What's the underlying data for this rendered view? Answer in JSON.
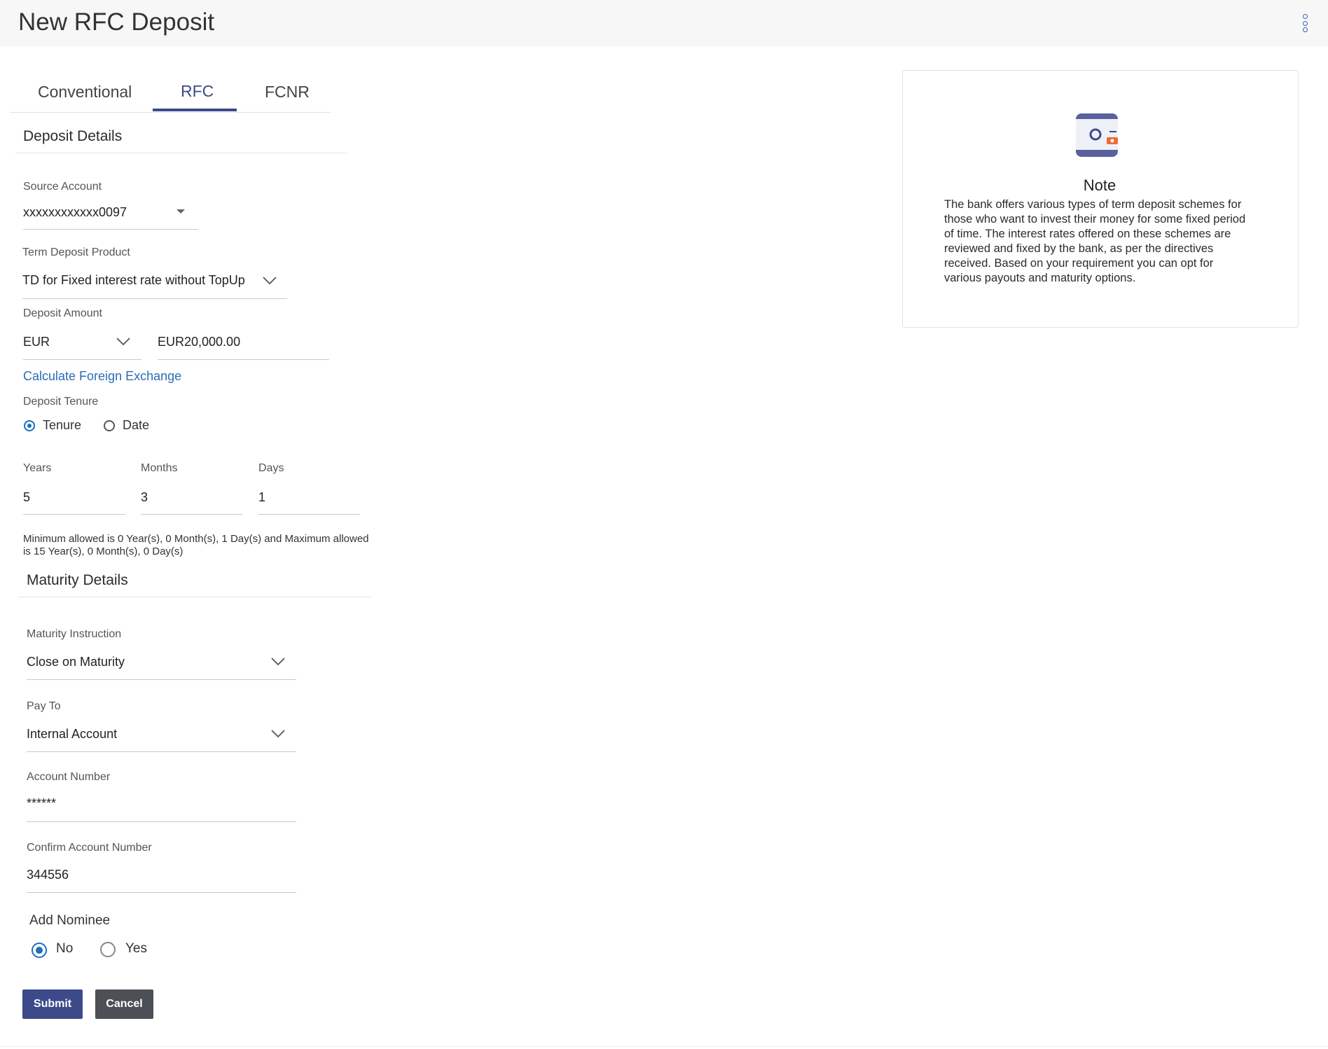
{
  "header": {
    "title": "New RFC Deposit",
    "menu_icon": "kebab-menu-icon"
  },
  "tabs": [
    {
      "label": "Conventional"
    },
    {
      "label": "RFC",
      "active": true
    },
    {
      "label": "FCNR"
    }
  ],
  "deposit_details": {
    "title": "Deposit Details",
    "source_account": {
      "label": "Source Account",
      "value": "xxxxxxxxxxxx0097"
    },
    "product": {
      "label": "Term Deposit Product",
      "value": "TD for Fixed interest rate without TopUp"
    },
    "amount": {
      "label": "Deposit Amount",
      "currency": "EUR",
      "value": "EUR20,000.00"
    },
    "fx_link": "Calculate Foreign Exchange",
    "tenure": {
      "label": "Deposit Tenure",
      "options": [
        {
          "label": "Tenure",
          "checked": true
        },
        {
          "label": "Date",
          "checked": false
        }
      ],
      "years": {
        "label": "Years",
        "value": "5"
      },
      "months": {
        "label": "Months",
        "value": "3"
      },
      "days": {
        "label": "Days",
        "value": "1"
      },
      "help": "Minimum allowed is 0 Year(s), 0 Month(s), 1 Day(s) and Maximum allowed is 15 Year(s), 0 Month(s), 0 Day(s)"
    }
  },
  "maturity_details": {
    "title": "Maturity Details",
    "instruction": {
      "label": "Maturity Instruction",
      "value": "Close on Maturity"
    },
    "pay_to": {
      "label": "Pay To",
      "value": "Internal Account"
    },
    "account_number": {
      "label": "Account Number",
      "value": "******"
    },
    "confirm_account_number": {
      "label": "Confirm Account Number",
      "value": "344556"
    }
  },
  "nominee": {
    "label": "Add Nominee",
    "options": [
      {
        "label": "No",
        "checked": true
      },
      {
        "label": "Yes",
        "checked": false
      }
    ]
  },
  "actions": {
    "submit": "Submit",
    "cancel": "Cancel"
  },
  "note": {
    "title": "Note",
    "icon": "safe-deposit-icon",
    "text": "The bank offers various types of term deposit schemes for those who want to invest their money for some fixed period of time. The interest rates offered on these schemes are reviewed and fixed by the bank, as per the directives received. Based on your requirement you can opt for various payouts and maturity options."
  },
  "colors": {
    "primary": "#3d4a8a",
    "link": "#2c6db5",
    "radio": "#1b6fc2",
    "cancel": "#4c4f56",
    "accent": "#f06a3a"
  }
}
